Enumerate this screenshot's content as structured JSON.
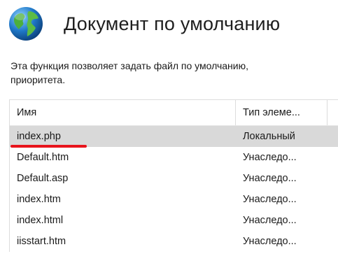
{
  "header": {
    "title": "Документ по умолчанию",
    "icon": "globe-icon"
  },
  "description": {
    "line1": "Эта функция позволяет задать файл по умолчанию,",
    "line2": "приоритета."
  },
  "table": {
    "columns": [
      "Имя",
      "Тип элеме..."
    ],
    "rows": [
      {
        "name": "index.php",
        "type": "Локальный",
        "selected": true
      },
      {
        "name": "Default.htm",
        "type": "Унаследо..."
      },
      {
        "name": "Default.asp",
        "type": "Унаследо..."
      },
      {
        "name": "index.htm",
        "type": "Унаследо..."
      },
      {
        "name": "index.html",
        "type": "Унаследо..."
      },
      {
        "name": "iisstart.htm",
        "type": "Унаследо..."
      }
    ]
  },
  "colors": {
    "selected_row": "#d9d9d9",
    "annotation_underline": "#e8141c",
    "globe_blue": "#1f78c8",
    "globe_green": "#4caf3c"
  }
}
